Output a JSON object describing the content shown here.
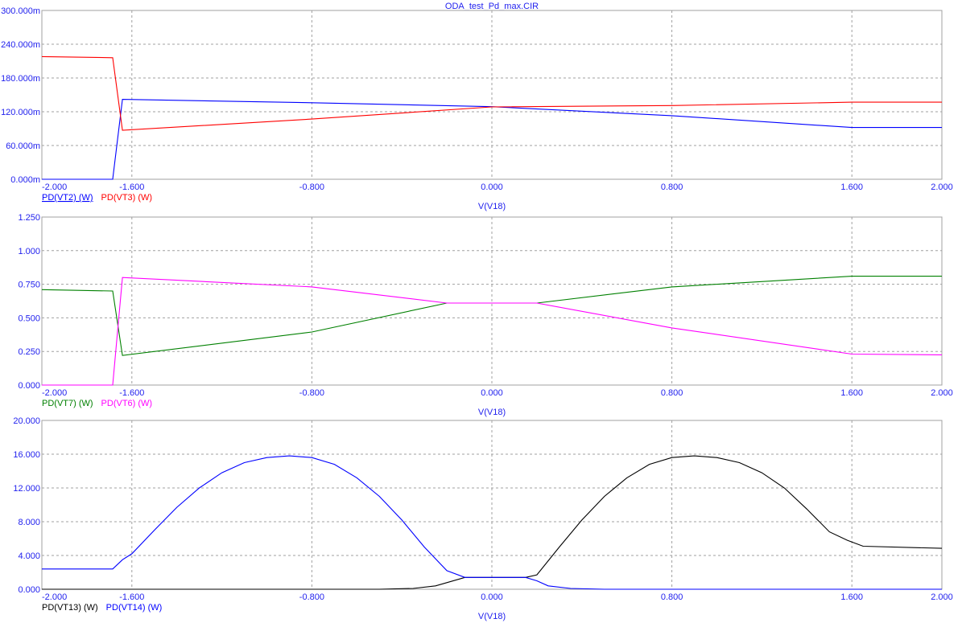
{
  "title": "ODA_test_Pd_max.CIR",
  "colors": {
    "axis_text": "#2222ee",
    "grid": "#a0a0a0",
    "frame": "#a0a0a0"
  },
  "chart_data": [
    {
      "type": "line",
      "xlabel": "V(V18)",
      "xlim": [
        -2,
        2
      ],
      "xticks": [
        -2,
        -1.6,
        -0.8,
        0,
        0.8,
        1.6,
        2
      ],
      "xtick_labels": [
        "-2.000",
        "-1.600",
        "-0.800",
        "0.000",
        "0.800",
        "1.600",
        "2.000"
      ],
      "ylim": [
        0,
        0.3
      ],
      "yticks": [
        0,
        0.06,
        0.12,
        0.18,
        0.24,
        0.3
      ],
      "ytick_labels": [
        "0.000m",
        "60.000m",
        "120.000m",
        "180.000m",
        "240.000m",
        "300.000m"
      ],
      "grid": true,
      "legend": "bottom-left",
      "series": [
        {
          "name": "PD(VT2) (W)",
          "color": "#0000ff",
          "underline": true,
          "x": [
            -2,
            -1.685,
            -1.642,
            -0.8,
            0,
            0.8,
            1.6,
            2
          ],
          "y": [
            0,
            0,
            0.142,
            0.136,
            0.129,
            0.113,
            0.092,
            0.092
          ]
        },
        {
          "name": "PD(VT3) (W)",
          "color": "#ff0000",
          "underline": false,
          "x": [
            -2,
            -1.685,
            -1.642,
            -0.8,
            0,
            0.8,
            1.6,
            2
          ],
          "y": [
            0.218,
            0.216,
            0.087,
            0.107,
            0.1286,
            0.131,
            0.137,
            0.137
          ]
        }
      ]
    },
    {
      "type": "line",
      "xlabel": "V(V18)",
      "xlim": [
        -2,
        2
      ],
      "xticks": [
        -2,
        -1.6,
        -0.8,
        0,
        0.8,
        1.6,
        2
      ],
      "xtick_labels": [
        "-2.000",
        "-1.600",
        "-0.800",
        "0.000",
        "0.800",
        "1.600",
        "2.000"
      ],
      "ylim": [
        0,
        1.25
      ],
      "yticks": [
        0,
        0.25,
        0.5,
        0.75,
        1.0,
        1.25
      ],
      "ytick_labels": [
        "0.000",
        "0.250",
        "0.500",
        "0.750",
        "1.000",
        "1.250"
      ],
      "grid": true,
      "legend": "bottom-left",
      "series": [
        {
          "name": "PD(VT7) (W)",
          "color": "#008000",
          "underline": false,
          "x": [
            -2,
            -1.685,
            -1.642,
            -0.8,
            -0.2,
            0.2,
            0.8,
            1.6,
            2
          ],
          "y": [
            0.71,
            0.7,
            0.22,
            0.395,
            0.61,
            0.61,
            0.73,
            0.81,
            0.81
          ]
        },
        {
          "name": "PD(VT6) (W)",
          "color": "#ff00ff",
          "underline": false,
          "x": [
            -2,
            -1.685,
            -1.642,
            -0.8,
            -0.2,
            0.2,
            0.8,
            1.6,
            2
          ],
          "y": [
            0,
            0,
            0.8,
            0.73,
            0.61,
            0.61,
            0.425,
            0.23,
            0.225
          ]
        }
      ]
    },
    {
      "type": "line",
      "xlabel": "V(V18)",
      "xlim": [
        -2,
        2
      ],
      "xticks": [
        -2,
        -1.6,
        -0.8,
        0,
        0.8,
        1.6,
        2
      ],
      "xtick_labels": [
        "-2.000",
        "-1.600",
        "-0.800",
        "0.000",
        "0.800",
        "1.600",
        "2.000"
      ],
      "ylim": [
        0,
        20
      ],
      "yticks": [
        0,
        4,
        8,
        12,
        16,
        20
      ],
      "ytick_labels": [
        "0.000",
        "4.000",
        "8.000",
        "12.000",
        "16.000",
        "20.000"
      ],
      "grid": true,
      "legend": "bottom-left",
      "series": [
        {
          "name": "PD(VT13) (W)",
          "color": "#000000",
          "underline": false,
          "x": [
            -2,
            -0.5,
            -0.35,
            -0.25,
            -0.12,
            0.15,
            0.2,
            0.3,
            0.4,
            0.5,
            0.6,
            0.7,
            0.8,
            0.9,
            1.0,
            1.1,
            1.2,
            1.3,
            1.4,
            1.5,
            1.58,
            1.65,
            2
          ],
          "y": [
            0,
            0,
            0.1,
            0.4,
            1.4,
            1.4,
            1.7,
            5,
            8.2,
            11,
            13.2,
            14.8,
            15.6,
            15.8,
            15.6,
            15,
            13.8,
            12,
            9.5,
            6.8,
            5.8,
            5.1,
            4.85
          ]
        },
        {
          "name": "PD(VT14) (W)",
          "color": "#0000ff",
          "underline": false,
          "x": [
            -2,
            -1.685,
            -1.642,
            -1.6,
            -1.5,
            -1.4,
            -1.3,
            -1.2,
            -1.1,
            -1.0,
            -0.9,
            -0.8,
            -0.7,
            -0.6,
            -0.5,
            -0.4,
            -0.3,
            -0.2,
            -0.12,
            0.15,
            0.2,
            0.25,
            0.35,
            0.5,
            2
          ],
          "y": [
            2.4,
            2.4,
            3.5,
            4.2,
            7,
            9.7,
            12,
            13.8,
            15,
            15.6,
            15.8,
            15.6,
            14.8,
            13.2,
            11,
            8.2,
            5,
            2.2,
            1.4,
            1.4,
            1.0,
            0.4,
            0.1,
            0,
            0
          ]
        }
      ]
    }
  ]
}
